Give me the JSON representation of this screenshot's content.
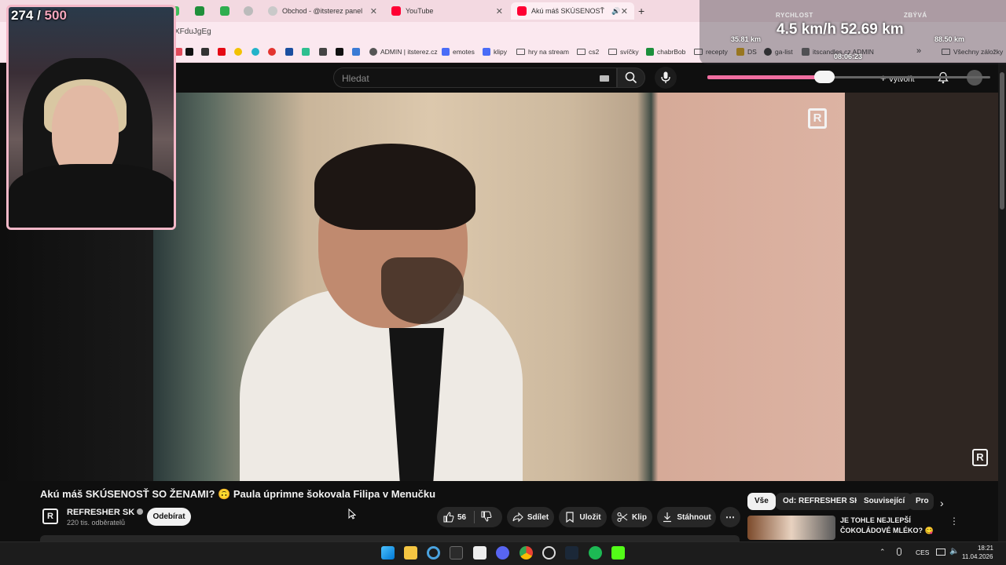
{
  "browser": {
    "tabs": [
      {
        "label": "Obchod - @itsterez panel",
        "active": false
      },
      {
        "label": "YouTube",
        "active": false
      },
      {
        "label": "Akú máš SKÚSENOSŤ SO ŽENAMI?",
        "active": true
      }
    ],
    "new_tab": "+",
    "url_fragment": "XFduJgEg",
    "bookmarks": [
      "ADMIN | itsterez.cz",
      "emotes",
      "klipy",
      "hry na stream",
      "cs2",
      "svíčky",
      "chabrBob",
      "recepty",
      "DS",
      "ga-list",
      "itscandles.cz ADMIN",
      "Všechny záložky"
    ],
    "overflow": "»"
  },
  "youtube": {
    "search_placeholder": "Hledat",
    "create_label": "Vytvořit",
    "video": {
      "title": "Akú máš SKÚSENOSŤ SO ŽENAMI? 🙃 Paula úprimne šokovala Filipa v Menučku",
      "channel_logo": "R",
      "channel_name": "REFRESHER SK",
      "subscribers": "220 tis. odběratelů",
      "subscribe_label": "Odebírat",
      "like_count": "56",
      "share_label": "Sdílet",
      "save_label": "Uložit",
      "clip_label": "Klip",
      "download_label": "Stáhnout",
      "more_label": "⋯"
    },
    "chips": [
      {
        "label": "Vše",
        "active": true
      },
      {
        "label": "Od: REFRESHER SK",
        "active": false
      },
      {
        "label": "Související",
        "active": false
      },
      {
        "label": "Pro",
        "active": false
      }
    ],
    "recommendation": {
      "title_line1": "JE TOHLE NEJLEPŠÍ",
      "title_line2": "ČOKOLÁDOVÉ MLÉKO? 😋"
    }
  },
  "overlay": {
    "counter_current": "274",
    "counter_sep": " / ",
    "counter_goal": "500",
    "speed_label": "RYCHLOST",
    "remaining_label": "ZBÝVÁ",
    "traveled": "35.81 km",
    "speed_and_distance": "4.5 km/h 52.69 km",
    "remaining": "88.50 km",
    "timer": "08:06:23",
    "progress_fraction": 0.42
  },
  "taskbar": {
    "language": "CES",
    "time": "18:21",
    "date": "11.04.2026"
  },
  "colors": {
    "accent_pink": "#f06ea0",
    "cam_border": "#f4b8c8",
    "youtube_red": "#ff0033"
  }
}
